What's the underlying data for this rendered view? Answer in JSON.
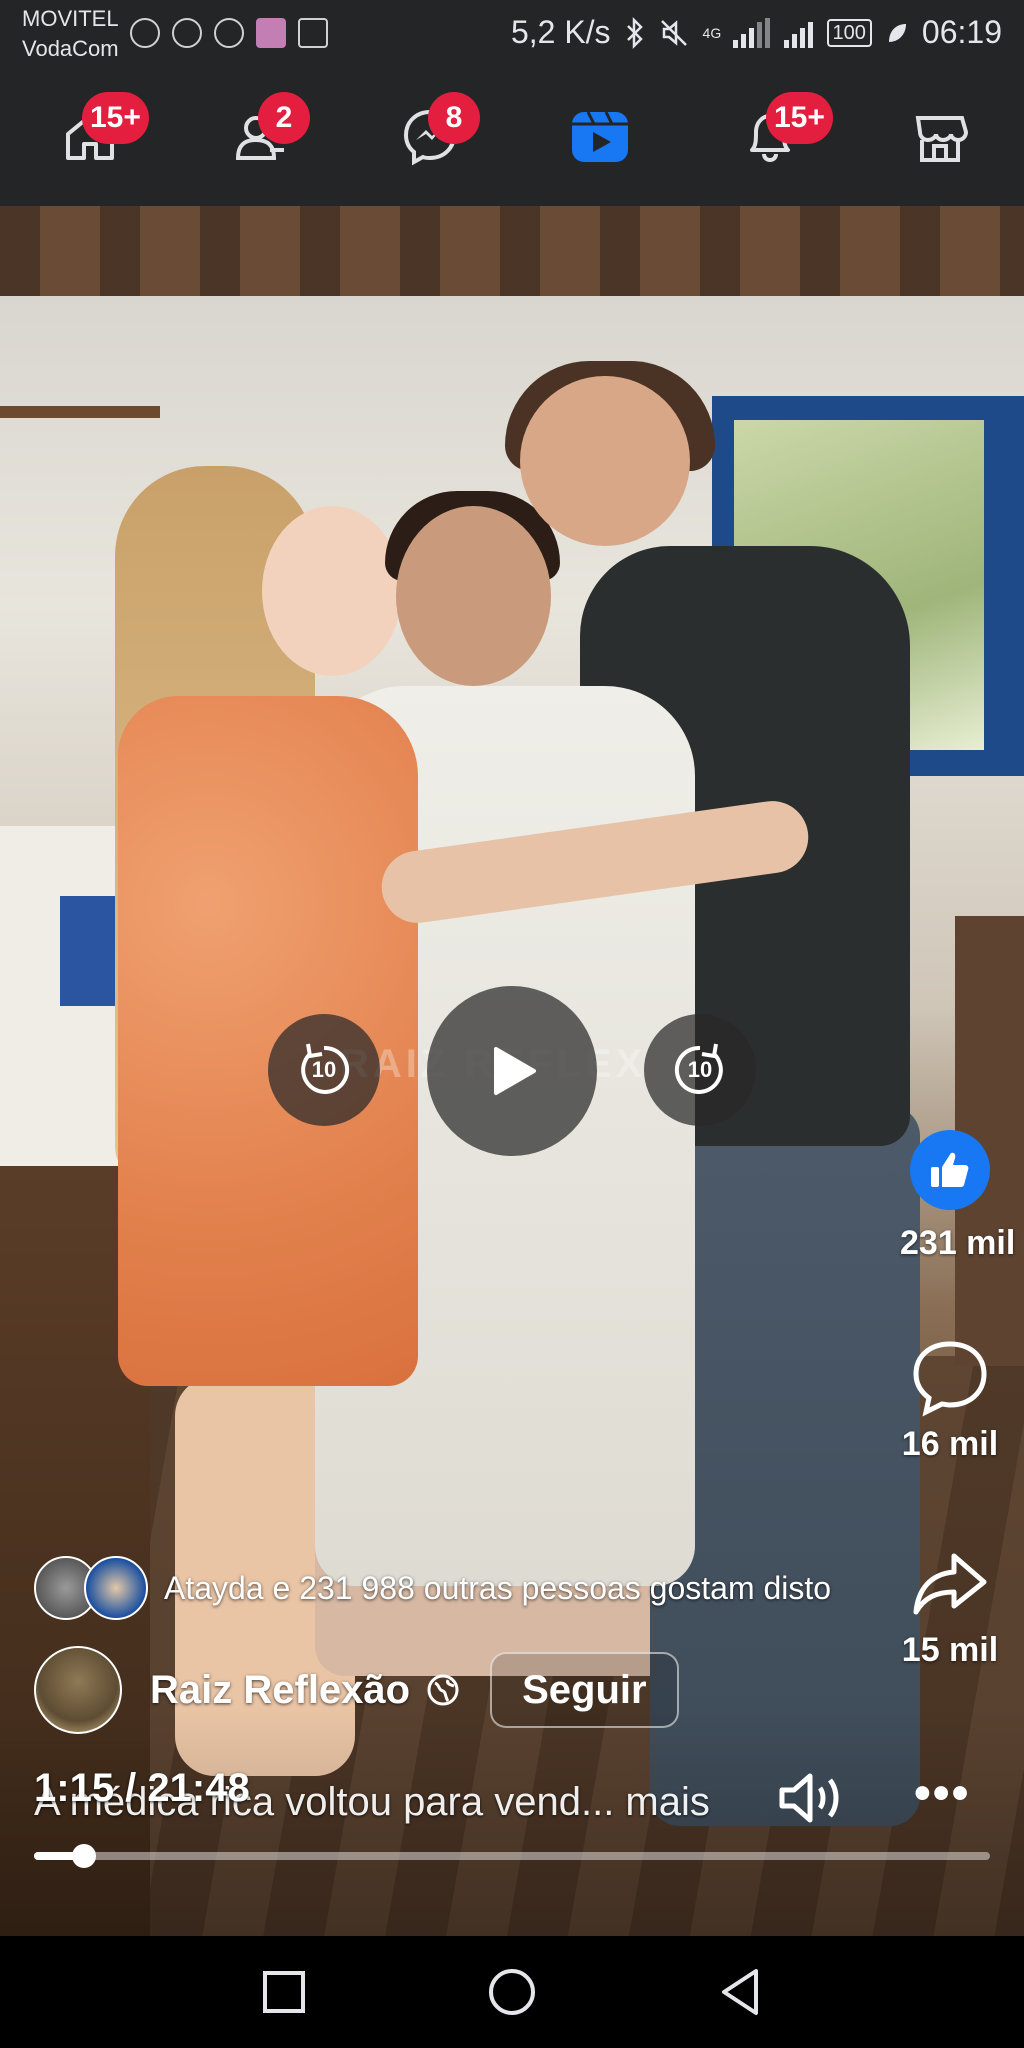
{
  "status_bar": {
    "carrier1": "MOVITEL",
    "carrier2": "VodaCom",
    "speed": "5,2 K/s",
    "network": "4G",
    "battery": "100",
    "time": "06:19"
  },
  "nav": {
    "items": [
      {
        "name": "home",
        "badge": "15+"
      },
      {
        "name": "friends",
        "badge": "2"
      },
      {
        "name": "messenger",
        "badge": "8"
      },
      {
        "name": "video",
        "badge": ""
      },
      {
        "name": "notifications",
        "badge": "15+"
      },
      {
        "name": "marketplace",
        "badge": ""
      }
    ],
    "active_color": "#1877f2",
    "badge_color": "#e41e3f"
  },
  "video": {
    "controls": {
      "rewind_seconds": "10",
      "forward_seconds": "10"
    },
    "watermark": "RAIZ REFLEX",
    "reactions": {
      "likes": "231 mil",
      "comments": "16 mil",
      "shares": "15 mil"
    },
    "likes_summary": "Atayda e 231 988 outras pessoas gostam disto",
    "author": "Raiz Reflexão",
    "follow_label": "Seguir",
    "time": "1:15 / 21:48",
    "caption": "A médica rica voltou para vend... mais",
    "progress_fraction": 0.0528
  }
}
